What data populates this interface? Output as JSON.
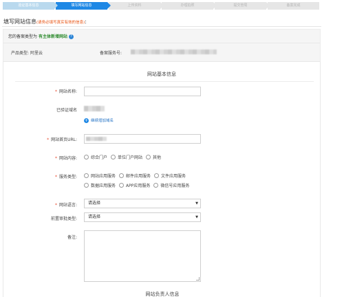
{
  "steps": [
    "验证基本信息",
    "填写网站信息",
    "上传资料",
    "办理拍照",
    "提交管局",
    "备案完成"
  ],
  "page_title": "填写网站信息",
  "page_note": "(请务必填写真实有效的信息)",
  "filing_type_label": "您的备案类型为",
  "filing_type_value": "有主体新增网站",
  "product_type_label": "产品类型:",
  "product_type_value": "阿里云",
  "service_no_label": "备案服务号:",
  "section1_title": "网站基本信息",
  "fields": {
    "site_name": "网站名称:",
    "verified_domain": "已验证域名",
    "add_domain": "继续增加域名",
    "homepage_url": "网站首页URL:",
    "site_content": "网站内容:",
    "service_type": "服务类型:",
    "language": "网站语言:",
    "pre_approval": "前置审批类型:",
    "remark": "备注:"
  },
  "site_content_options": [
    "综合门户",
    "单位门户网站",
    "其他"
  ],
  "service_type_options_row1": [
    "网站应用服务",
    "邮件应用服务",
    "文件应用服务"
  ],
  "service_type_options_row2": [
    "数据应用服务",
    "APP应用服务",
    "微信号应用服务"
  ],
  "select_placeholder": "请选择",
  "section2_title": "网站负责人信息",
  "colors": {
    "accent": "#1e88e5",
    "required": "#e84a2e",
    "note": "#e8500e",
    "type_value": "#2e8b2e"
  }
}
